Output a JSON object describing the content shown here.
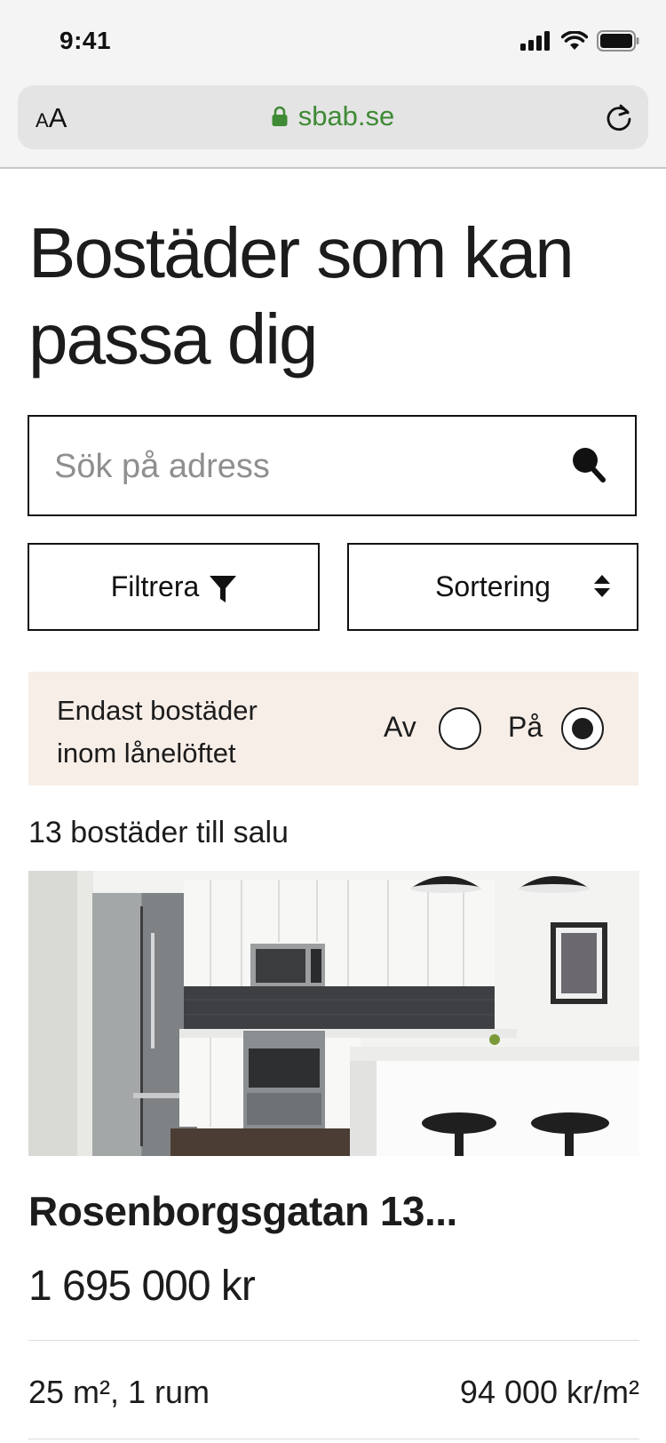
{
  "status_bar": {
    "time": "9:41",
    "icons": [
      "cellular-signal-icon",
      "wifi-icon",
      "battery-icon"
    ]
  },
  "browser": {
    "text_size_small": "A",
    "text_size_big": "A",
    "url": "sbab.se",
    "icons": [
      "lock-icon",
      "reload-icon"
    ]
  },
  "page": {
    "title": "Bostäder som kan passa dig"
  },
  "search": {
    "placeholder": "Sök på adress",
    "value": "",
    "icon": "search-icon"
  },
  "actions": {
    "filter_label": "Filtrera",
    "filter_icon": "filter-funnel-icon",
    "sort_label": "Sortering",
    "sort_icon": "sort-arrows-icon"
  },
  "loan_filter": {
    "label": "Endast bostäder inom lånelöftet",
    "off_label": "Av",
    "on_label": "På",
    "selected": "På"
  },
  "results": {
    "count_text": "13 bostäder till salu"
  },
  "listing": {
    "title": "Rosenborgsgatan 13...",
    "price": "1 695 000 kr",
    "size_rooms": "25 m², 1 rum",
    "price_per_sqm": "94 000 kr/m²"
  },
  "colors": {
    "url_green": "#3f8a35",
    "panel_beige": "#f7eee8",
    "text_dark": "#1c1c1c"
  }
}
